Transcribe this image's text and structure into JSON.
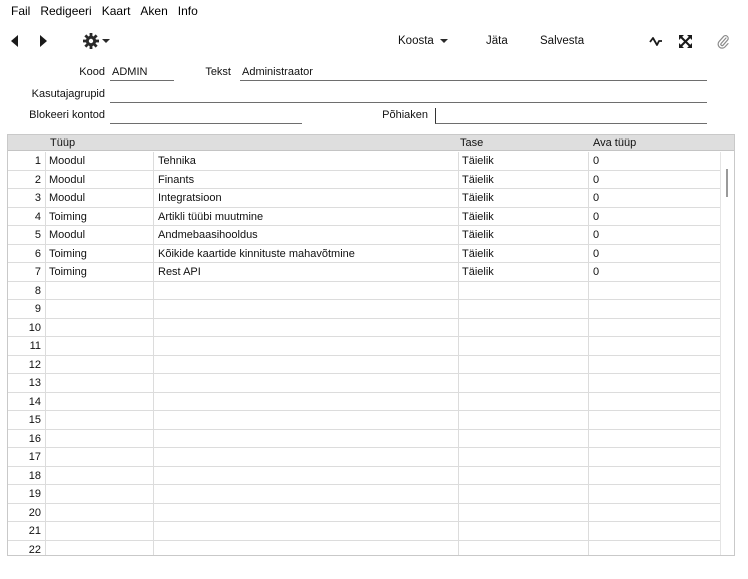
{
  "menu": [
    "Fail",
    "Redigeeri",
    "Kaart",
    "Aken",
    "Info"
  ],
  "toolbar": {
    "back_icon": "triangle-left-icon",
    "forward_icon": "triangle-right-icon",
    "gear_icon": "gear-icon",
    "koosta_label": "Koosta",
    "jata_label": "Jäta",
    "salvesta_label": "Salvesta",
    "activity_icon": "pulse-icon",
    "expand_icon": "expand-icon",
    "attach_icon": "paperclip-icon"
  },
  "form": {
    "kood_label": "Kood",
    "kood_value": "ADMIN",
    "tekst_label": "Tekst",
    "tekst_value": "Administraator",
    "kasutajagrupid_label": "Kasutajagrupid",
    "kasutajagrupid_value": "",
    "blokeeri_label": "Blokeeri kontod",
    "blokeeri_value": "",
    "pohiaken_label": "Põhiaken",
    "pohiaken_value": ""
  },
  "grid": {
    "headers": {
      "tyyp": "Tüüp",
      "tase": "Tase",
      "ava_tyyp": "Ava tüüp"
    },
    "rows": [
      {
        "n": "1",
        "t1": "Moodul",
        "t2": "Tehnika",
        "tase": "Täielik",
        "ava": "0"
      },
      {
        "n": "2",
        "t1": "Moodul",
        "t2": "Finants",
        "tase": "Täielik",
        "ava": "0"
      },
      {
        "n": "3",
        "t1": "Moodul",
        "t2": "Integratsioon",
        "tase": "Täielik",
        "ava": "0"
      },
      {
        "n": "4",
        "t1": "Toiming",
        "t2": "Artikli tüübi muutmine",
        "tase": "Täielik",
        "ava": "0"
      },
      {
        "n": "5",
        "t1": "Moodul",
        "t2": "Andmebaasihooldus",
        "tase": "Täielik",
        "ava": "0"
      },
      {
        "n": "6",
        "t1": "Toiming",
        "t2": "Kõikide kaartide kinnituste mahavõtmine",
        "tase": "Täielik",
        "ava": "0"
      },
      {
        "n": "7",
        "t1": "Toiming",
        "t2": "Rest API",
        "tase": "Täielik",
        "ava": "0"
      },
      {
        "n": "8",
        "t1": "",
        "t2": "",
        "tase": "",
        "ava": ""
      },
      {
        "n": "9",
        "t1": "",
        "t2": "",
        "tase": "",
        "ava": ""
      },
      {
        "n": "10",
        "t1": "",
        "t2": "",
        "tase": "",
        "ava": ""
      },
      {
        "n": "11",
        "t1": "",
        "t2": "",
        "tase": "",
        "ava": ""
      },
      {
        "n": "12",
        "t1": "",
        "t2": "",
        "tase": "",
        "ava": ""
      },
      {
        "n": "13",
        "t1": "",
        "t2": "",
        "tase": "",
        "ava": ""
      },
      {
        "n": "14",
        "t1": "",
        "t2": "",
        "tase": "",
        "ava": ""
      },
      {
        "n": "15",
        "t1": "",
        "t2": "",
        "tase": "",
        "ava": ""
      },
      {
        "n": "16",
        "t1": "",
        "t2": "",
        "tase": "",
        "ava": ""
      },
      {
        "n": "17",
        "t1": "",
        "t2": "",
        "tase": "",
        "ava": ""
      },
      {
        "n": "18",
        "t1": "",
        "t2": "",
        "tase": "",
        "ava": ""
      },
      {
        "n": "19",
        "t1": "",
        "t2": "",
        "tase": "",
        "ava": ""
      },
      {
        "n": "20",
        "t1": "",
        "t2": "",
        "tase": "",
        "ava": ""
      },
      {
        "n": "21",
        "t1": "",
        "t2": "",
        "tase": "",
        "ava": ""
      },
      {
        "n": "22",
        "t1": "",
        "t2": "",
        "tase": "",
        "ava": ""
      }
    ]
  }
}
